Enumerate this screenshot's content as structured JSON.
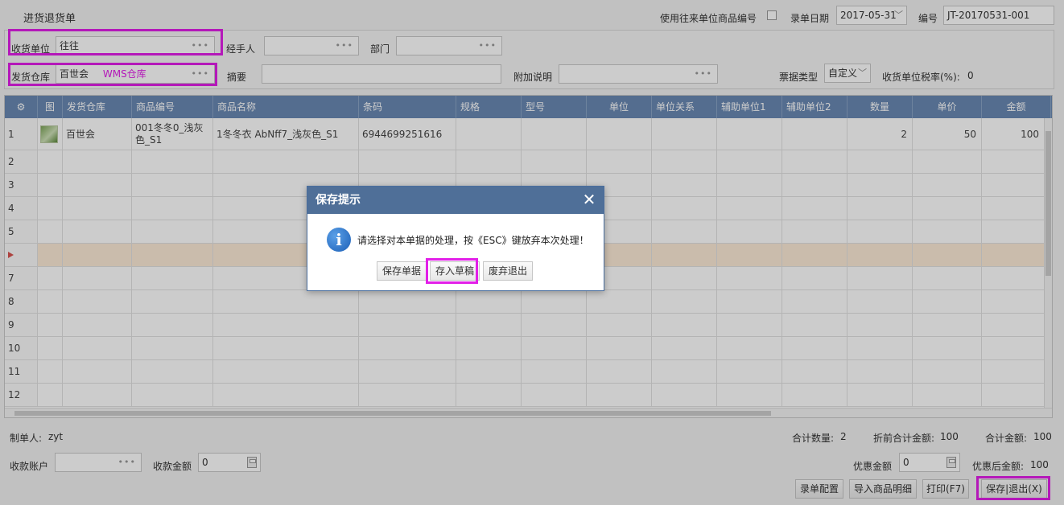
{
  "page": {
    "title": "进货退货单"
  },
  "header": {
    "use_code_label": "使用往来单位商品编号",
    "date_label": "录单日期",
    "date_value": "2017-05-31",
    "number_label": "编号",
    "number_value": "JT-20170531-001"
  },
  "form": {
    "receiver_label": "收货单位",
    "receiver_value": "往往",
    "handler_label": "经手人",
    "department_label": "部门",
    "warehouse_label": "发货仓库",
    "warehouse_value": "百世会",
    "warehouse_tag": "WMS仓库",
    "summary_label": "摘要",
    "note_label": "附加说明",
    "invoice_type_label": "票据类型",
    "invoice_type_value": "自定义",
    "tax_rate_label": "收货单位税率(%):",
    "tax_rate_value": "0"
  },
  "grid": {
    "columns": [
      "图",
      "发货仓库",
      "商品编号",
      "商品名称",
      "条码",
      "规格",
      "型号",
      "单位",
      "单位关系",
      "辅助单位1",
      "辅助单位2",
      "数量",
      "单价",
      "金额"
    ],
    "rows": [
      {
        "no": "1",
        "warehouse": "百世会",
        "code": "001冬冬0_浅灰色_S1",
        "name": "1冬冬衣 AbNff7_浅灰色_S1",
        "barcode": "6944699251616",
        "qty": "2",
        "price": "50",
        "amount": "100"
      },
      {
        "no": "2"
      },
      {
        "no": "3"
      },
      {
        "no": "4"
      },
      {
        "no": "5"
      },
      {
        "no": ""
      },
      {
        "no": "7"
      },
      {
        "no": "8"
      },
      {
        "no": "9"
      },
      {
        "no": "10"
      },
      {
        "no": "11"
      },
      {
        "no": "12"
      }
    ]
  },
  "footer": {
    "creator_label": "制单人:",
    "creator_value": "zyt",
    "total_qty_label": "合计数量:",
    "total_qty_value": "2",
    "pre_discount_label": "折前合计金额:",
    "pre_discount_value": "100",
    "total_amount_label": "合计金额:",
    "total_amount_value": "100",
    "account_label": "收款账户",
    "received_label": "收款金额",
    "received_value": "0",
    "discount_label": "优惠金额",
    "discount_value": "0",
    "after_discount_label": "优惠后金额:",
    "after_discount_value": "100"
  },
  "buttons": {
    "config": "录单配置",
    "import": "导入商品明细",
    "print": "打印(F7)",
    "save_exit": "保存|退出(X)"
  },
  "dialog": {
    "title": "保存提示",
    "message": "请选择对本单据的处理，按《ESC》键放弃本次处理！",
    "save_btn": "保存单据",
    "draft_btn": "存入草稿",
    "discard_btn": "废弃退出"
  },
  "colors": {
    "highlight": "#e21fe8",
    "grid_header": "#6a89b3",
    "dialog_title": "#4f6f98",
    "selected_row": "#fdebd7"
  }
}
